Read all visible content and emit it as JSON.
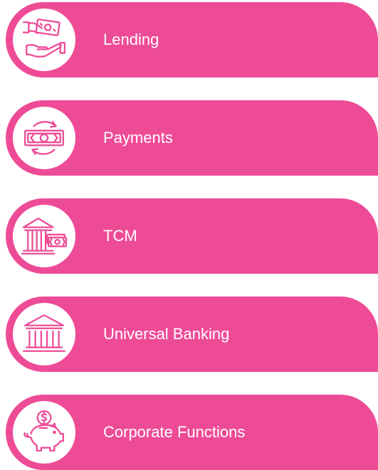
{
  "colors": {
    "pill": "#ee4b97",
    "icon_stroke": "#ee4b97",
    "circle": "#ffffff",
    "label": "#ffffff"
  },
  "menu": {
    "items": [
      {
        "label": "Lending",
        "icon": "hand-money-icon"
      },
      {
        "label": "Payments",
        "icon": "money-exchange-icon"
      },
      {
        "label": "TCM",
        "icon": "bank-money-icon"
      },
      {
        "label": "Universal Banking",
        "icon": "bank-icon"
      },
      {
        "label": "Corporate Functions",
        "icon": "piggy-bank-icon"
      }
    ]
  }
}
